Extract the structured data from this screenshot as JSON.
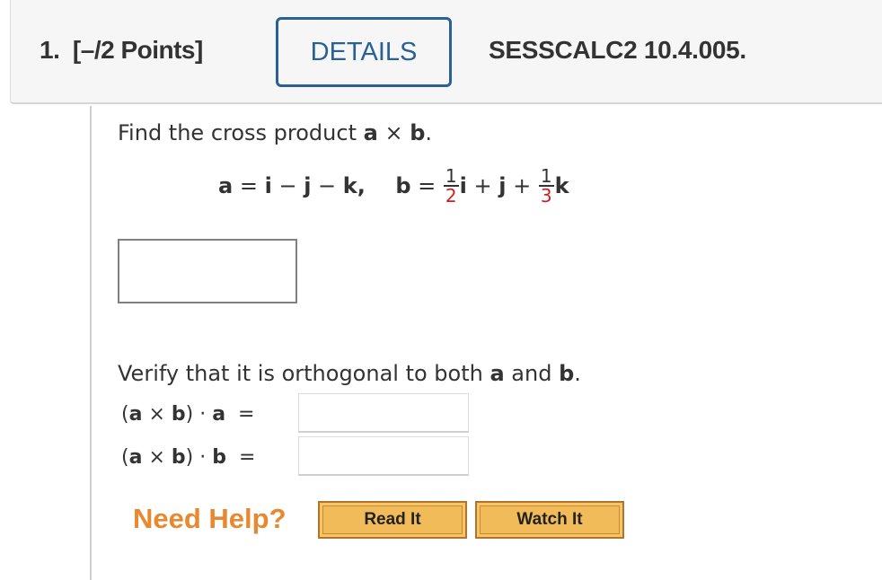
{
  "header": {
    "question_number": "1.",
    "points": "[–/2 Points]",
    "details_label": "DETAILS",
    "question_code": "SESSCALC2 10.4.005."
  },
  "problem": {
    "prompt_prefix": "Find the cross product ",
    "prompt_a": "a",
    "prompt_times": " × ",
    "prompt_b": "b",
    "prompt_suffix": ".",
    "formula": {
      "a_lhs": "a",
      "eq": " = ",
      "i": "i",
      "minus": " − ",
      "j": "j",
      "k": "k",
      "comma": ",    ",
      "b_lhs": "b",
      "plus": " + ",
      "frac1_num": "1",
      "frac1_den": "2",
      "frac2_num": "1",
      "frac2_den": "3"
    },
    "answer_value": ""
  },
  "verify": {
    "prefix": "Verify that it is orthogonal to both ",
    "a": "a",
    "and": " and ",
    "b": "b",
    "suffix": ".",
    "rows": [
      {
        "open": "(",
        "a": "a",
        "times": " × ",
        "b": "b",
        "close": ")",
        "dot": " · ",
        "vec": "a",
        "eq": "  =",
        "value": ""
      },
      {
        "open": "(",
        "a": "a",
        "times": " × ",
        "b": "b",
        "close": ")",
        "dot": " · ",
        "vec": "b",
        "eq": "  =",
        "value": ""
      }
    ]
  },
  "help": {
    "label": "Need Help?",
    "read_it": "Read It",
    "watch_it": "Watch It"
  },
  "colors": {
    "details_accent": "#2a6195",
    "fraction_denominator": "#cc2020",
    "need_help": "#e8882f",
    "help_button": "#f2bb5a"
  }
}
